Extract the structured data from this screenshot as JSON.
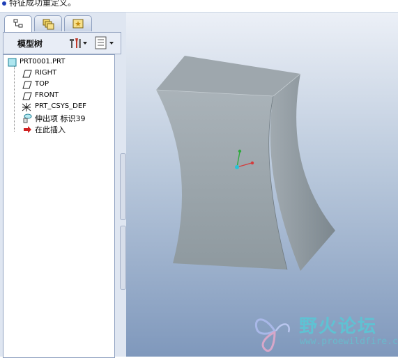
{
  "message_bar": {
    "text": "特征成功重定义。"
  },
  "model_tree": {
    "title": "模型树",
    "items": [
      {
        "label": "PRT0001.PRT",
        "icon": "part-icon"
      },
      {
        "label": "RIGHT",
        "icon": "datum-plane-icon"
      },
      {
        "label": "TOP",
        "icon": "datum-plane-icon"
      },
      {
        "label": "FRONT",
        "icon": "datum-plane-icon"
      },
      {
        "label": "PRT_CSYS_DEF",
        "icon": "csys-icon"
      },
      {
        "label": "伸出项 标识39",
        "icon": "extrude-feature-icon"
      },
      {
        "label": "在此插入",
        "icon": "insert-here-arrow-icon"
      }
    ]
  },
  "watermark": {
    "text": "野火论坛",
    "url": "www.proewildfire.cn"
  },
  "colors": {
    "panel_bg": "#dfe6f1",
    "viewport_top": "#ecf0f7",
    "viewport_bottom": "#7f98bc",
    "model_face": "#9ea7ad",
    "insert_arrow": "#d02020"
  }
}
